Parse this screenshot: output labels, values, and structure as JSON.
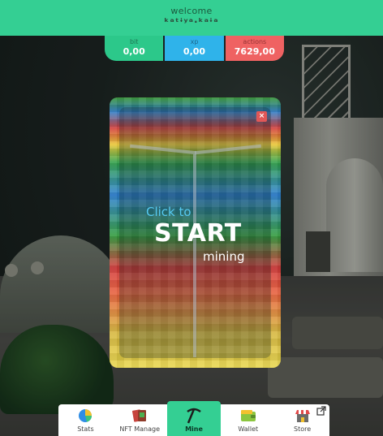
{
  "header": {
    "welcome": "welcome",
    "username": "ᵏᵃᵗᶤʸᵃ·ᵏᵃᶤᵃ"
  },
  "stats": [
    {
      "label": "bit",
      "value": "0,00",
      "color": "#2cc88a"
    },
    {
      "label": "xp",
      "value": "0,00",
      "color": "#2fb3ea"
    },
    {
      "label": "actions",
      "value": "7629,00",
      "color": "#ef6262"
    }
  ],
  "modal": {
    "close": "×",
    "line1": "Click to",
    "line2": "START",
    "line3": "mining"
  },
  "nav": {
    "items": [
      {
        "label": "Stats",
        "icon": "pie-chart-icon"
      },
      {
        "label": "NFT Manage",
        "icon": "cards-icon"
      },
      {
        "label": "Mine",
        "icon": "pickaxe-icon",
        "active": true
      },
      {
        "label": "Wallet",
        "icon": "wallet-icon"
      },
      {
        "label": "Store",
        "icon": "store-icon"
      }
    ],
    "external_icon": "external-link-icon"
  },
  "colors": {
    "brand": "#34cf93",
    "bit": "#2cc88a",
    "xp": "#2fb3ea",
    "actions": "#ef6262",
    "close": "#e25757",
    "start_accent": "#56c9f0"
  }
}
